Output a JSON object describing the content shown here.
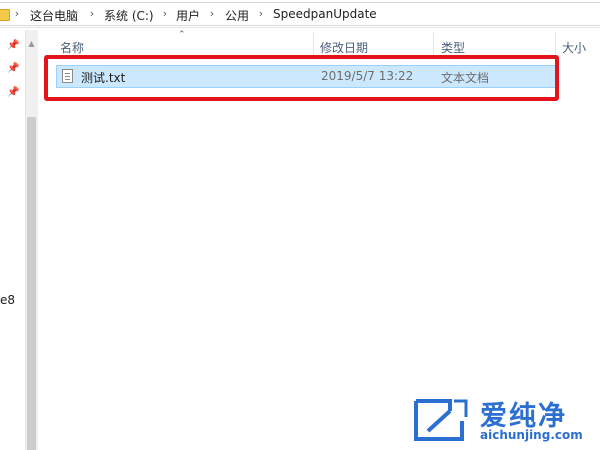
{
  "address_bar": {
    "crumbs": [
      "这台电脑",
      "系统 (C:)",
      "用户",
      "公用",
      "SpeedpanUpdate"
    ],
    "separator": "›"
  },
  "nav_pane": {
    "pins": [
      "pin-icon",
      "pin-icon",
      "pin-icon"
    ],
    "partial_text": "e8"
  },
  "columns": {
    "name": "名称",
    "modified": "修改日期",
    "type": "类型",
    "size": "大小"
  },
  "files": [
    {
      "name": "测试.txt",
      "modified": "2019/5/7 13:22",
      "type": "文本文档",
      "icon": "text-file-icon"
    }
  ],
  "watermark": {
    "brand": "爱纯净",
    "url": "aichunjing.com"
  },
  "colors": {
    "selection_bg": "#cce8ff",
    "selection_border": "#99d1ff",
    "highlight_box": "#e3141b",
    "watermark": "#2b6fd1"
  }
}
